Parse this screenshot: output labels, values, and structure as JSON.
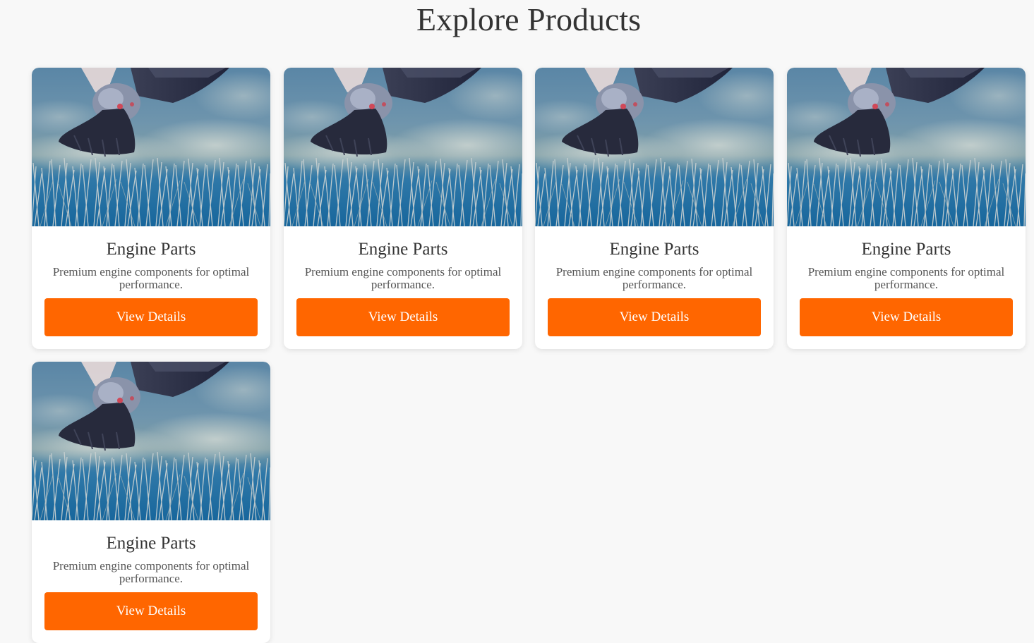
{
  "page": {
    "title": "Explore Products"
  },
  "colors": {
    "accent": "#ff6600",
    "background": "#f8f8f8",
    "card": "#ffffff"
  },
  "products": [
    {
      "image": "pigeon-over-bird-spikes",
      "title": "Engine Parts",
      "description": "Premium engine components for optimal performance.",
      "button_label": "View Details"
    },
    {
      "image": "pigeon-over-bird-spikes",
      "title": "Engine Parts",
      "description": "Premium engine components for optimal performance.",
      "button_label": "View Details"
    },
    {
      "image": "pigeon-over-bird-spikes",
      "title": "Engine Parts",
      "description": "Premium engine components for optimal performance.",
      "button_label": "View Details"
    },
    {
      "image": "pigeon-over-bird-spikes",
      "title": "Engine Parts",
      "description": "Premium engine components for optimal performance.",
      "button_label": "View Details"
    },
    {
      "image": "pigeon-over-bird-spikes",
      "title": "Engine Parts",
      "description": "Premium engine components for optimal performance.",
      "button_label": "View Details"
    }
  ]
}
